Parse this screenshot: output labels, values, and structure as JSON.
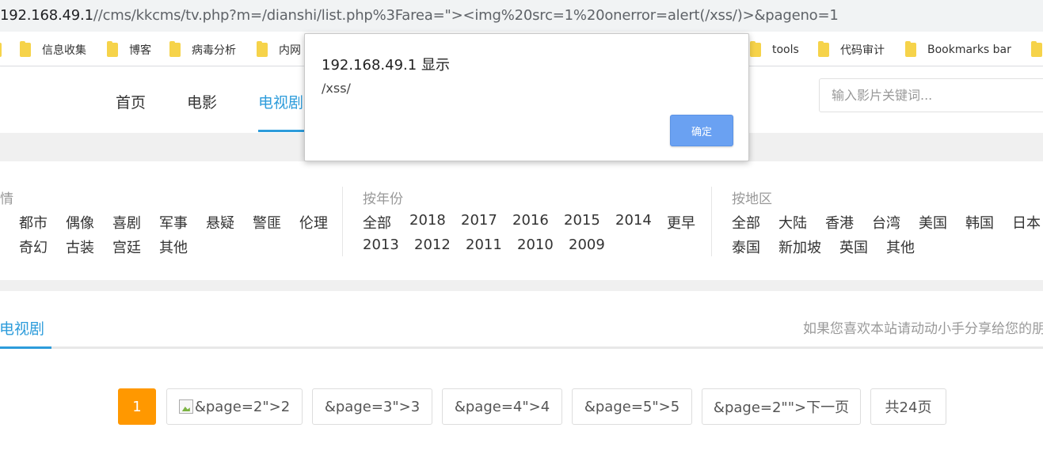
{
  "browser": {
    "url_host": "192.168.49.1",
    "url_rest": "//cms/kkcms/tv.php?m=/dianshi/list.php%3Farea=\"><img%20src=1%20onerror=alert(/xss/)>&pageno=1",
    "bookmarks_left": [
      "信息收集",
      "博客",
      "病毒分析",
      "内网"
    ],
    "bookmarks_right": [
      "tools",
      "代码审计",
      "Bookmarks bar"
    ]
  },
  "alert": {
    "title": "192.168.49.1 显示",
    "message": "/xss/",
    "ok_label": "确定"
  },
  "nav": {
    "items": [
      "首页",
      "电影",
      "电视剧"
    ],
    "search_placeholder": "输入影片关键词..."
  },
  "filters": {
    "genre": {
      "heading": "情",
      "row1": [
        "都市",
        "偶像",
        "喜剧",
        "军事",
        "悬疑",
        "警匪",
        "伦理"
      ],
      "row2": [
        "奇幻",
        "古装",
        "宫廷",
        "其他"
      ]
    },
    "year": {
      "heading": "按年份",
      "row1": [
        "全部",
        "2018",
        "2017",
        "2016",
        "2015",
        "2014",
        "更早"
      ],
      "row2": [
        "2013",
        "2012",
        "2011",
        "2010",
        "2009"
      ]
    },
    "area": {
      "heading": "按地区",
      "row1": [
        "全部",
        "大陆",
        "香港",
        "台湾",
        "美国",
        "韩国",
        "日本"
      ],
      "row2": [
        "泰国",
        "新加坡",
        "英国",
        "其他"
      ]
    }
  },
  "section": {
    "title": "新电视剧",
    "note": "如果您喜欢本站请动动小手分享给您的朋"
  },
  "pagination": {
    "current": "1",
    "p2": "&page=2\">2",
    "p3": "&page=3\">3",
    "p4": "&page=4\">4",
    "p5": "&page=5\">5",
    "next": "&page=2\"\">下一页",
    "total": "共24页"
  }
}
